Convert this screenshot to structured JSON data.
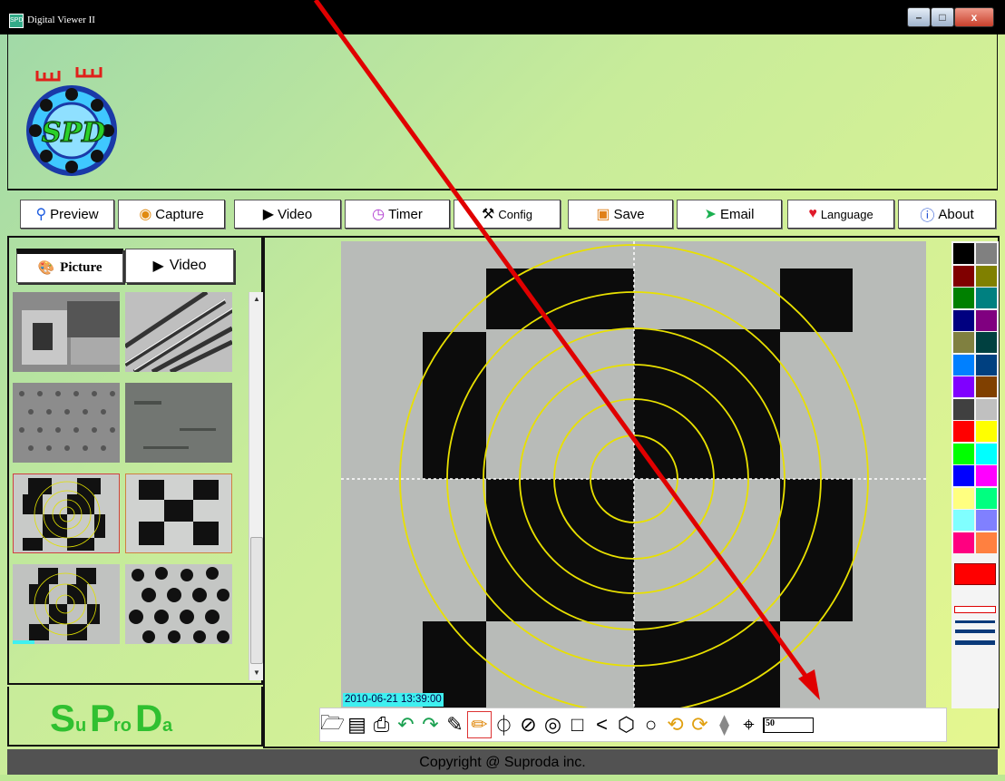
{
  "window": {
    "title": "Digital Viewer II",
    "min_label": "–",
    "max_label": "□",
    "close_label": "x"
  },
  "menu": {
    "preview": "Preview",
    "capture": "Capture",
    "video": "Video",
    "timer": "Timer",
    "config": "Config",
    "save": "Save",
    "email": "Email",
    "language": "Language",
    "about": "About"
  },
  "tabs": {
    "picture": "Picture",
    "video": "Video"
  },
  "brand": {
    "logo_text": "SPD",
    "name_letters": [
      "S",
      "u",
      "P",
      "ro",
      "D",
      "a"
    ]
  },
  "viewer": {
    "timestamp": "2010-06-21 13:39:00"
  },
  "toolbar": {
    "line_width_value": "50"
  },
  "footer": {
    "copyright": "Copyright @ Suproda inc."
  },
  "palette": {
    "swatches": [
      "#000000",
      "#808080",
      "#800000",
      "#808000",
      "#008000",
      "#008080",
      "#000080",
      "#800080",
      "#808040",
      "#004040",
      "#0080ff",
      "#004080",
      "#8000ff",
      "#804000",
      "#404040",
      "#c0c0c0",
      "#ff0000",
      "#ffff00",
      "#00ff00",
      "#00ffff",
      "#0000ff",
      "#ff00ff",
      "#ffff80",
      "#00ff80",
      "#80ffff",
      "#8080ff",
      "#ff0080",
      "#ff8040"
    ],
    "current_color": "#ff0000"
  },
  "colors": {
    "accent_arrow": "#e00000",
    "target_rings": "#e8e000"
  }
}
